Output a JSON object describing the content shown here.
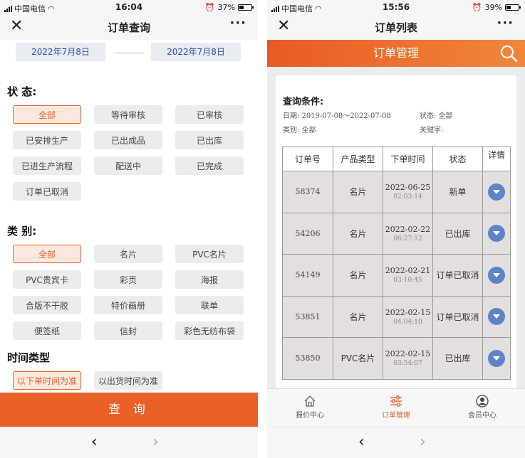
{
  "left": {
    "status": {
      "carrier": "中国电信",
      "time": "16:04",
      "battery": "37%",
      "battery_level": 0.37
    },
    "nav": {
      "title": "订单查询",
      "close": "✕",
      "more": "···"
    },
    "date_from": "2022年7月8日",
    "date_to": "2022年7月8日",
    "status_section": {
      "title": "状  态:",
      "options": [
        "全部",
        "等待审核",
        "已审核",
        "已安排生产",
        "已出成品",
        "已出库",
        "已进生产流程",
        "配送中",
        "已完成",
        "订单已取消"
      ],
      "selected": "全部"
    },
    "category_section": {
      "title": "类  别:",
      "options": [
        "全部",
        "名片",
        "PVC名片",
        "PVC贵宾卡",
        "彩页",
        "海报",
        "合版不干胶",
        "特价画册",
        "联单",
        "便签纸",
        "信封",
        "彩色无纺布袋"
      ],
      "selected": "全部"
    },
    "time_type_section": {
      "title": "时间类型",
      "options": [
        "以下单时间为准",
        "以出货时间为准"
      ],
      "selected": "以下单时间为准"
    },
    "query_button": "查 询",
    "bottom_nav": {
      "back": "‹",
      "forward": "›"
    }
  },
  "right": {
    "status": {
      "carrier": "中国电信",
      "time": "15:56",
      "battery": "39%",
      "battery_level": 0.39
    },
    "nav": {
      "title": "订单列表",
      "close": "✕",
      "more": "···"
    },
    "header": "订单管理",
    "query": {
      "title": "查询条件:",
      "date": "日期: 2019-07-08～2022-07-08",
      "status": "状态: 全部",
      "category": "类别: 全部",
      "keyword": "关键字:"
    },
    "table": {
      "headers": [
        "订单号",
        "产品类型",
        "下单时间",
        "状态",
        "详情"
      ],
      "rows": [
        {
          "id": "58374",
          "type": "名片",
          "date": "2022-06-25",
          "time": "02:03:14",
          "status": "新单"
        },
        {
          "id": "54206",
          "type": "名片",
          "date": "2022-02-22",
          "time": "06:27:12",
          "status": "已出库"
        },
        {
          "id": "54149",
          "type": "名片",
          "date": "2022-02-21",
          "time": "03:10:45",
          "status": "订单已取消"
        },
        {
          "id": "53851",
          "type": "名片",
          "date": "2022-02-15",
          "time": "04:04:10",
          "status": "订单已取消"
        },
        {
          "id": "53850",
          "type": "PVC名片",
          "date": "2022-02-15",
          "time": "03:54:07",
          "status": "已出库"
        }
      ]
    },
    "tabs": [
      {
        "label": "报价中心",
        "icon": "home-icon"
      },
      {
        "label": "订单管理",
        "icon": "sliders-icon",
        "active": true
      },
      {
        "label": "会员中心",
        "icon": "user-icon"
      }
    ],
    "bottom_nav": {
      "back": "‹",
      "forward": "›"
    }
  },
  "colors": {
    "accent": "#e96127",
    "selected_bg": "#fbe9df",
    "detail_button": "#5d84c9",
    "date_text": "#2a57a0"
  }
}
